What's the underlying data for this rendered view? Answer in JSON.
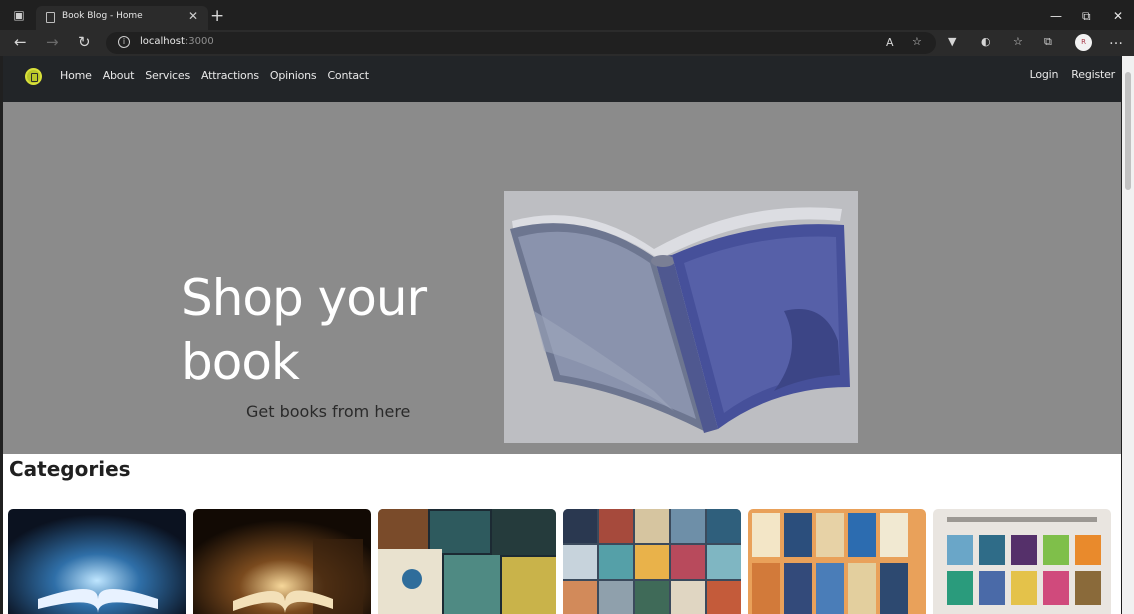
{
  "browser": {
    "tab_title": "Book Blog - Home",
    "url_host": "localhost",
    "url_port": ":3000",
    "profile_initials": "R",
    "window_controls": [
      "minimize-icon",
      "restore-icon",
      "close-icon"
    ]
  },
  "navbar": {
    "links": [
      "Home",
      "About",
      "Services",
      "Attractions",
      "Opinions",
      "Contact"
    ],
    "auth": [
      "Login",
      "Register"
    ]
  },
  "hero": {
    "title": "Shop your book",
    "subtitle": "Get books from here",
    "background_color": "#8b8b8b",
    "image": "open-blue-book-illustration"
  },
  "categories": {
    "heading": "Categories",
    "cards": [
      {
        "image": "glowing-magic-book"
      },
      {
        "image": "old-book-candlelight"
      },
      {
        "image": "bestseller-covers-collage"
      },
      {
        "image": "book-covers-grid"
      },
      {
        "image": "stephen-king-covers"
      },
      {
        "image": "dewey-decimal-system-chart"
      }
    ]
  },
  "colors": {
    "navbar_bg": "#222528",
    "browser_chrome": "#202020",
    "logo_accent": "#b9c62a"
  }
}
